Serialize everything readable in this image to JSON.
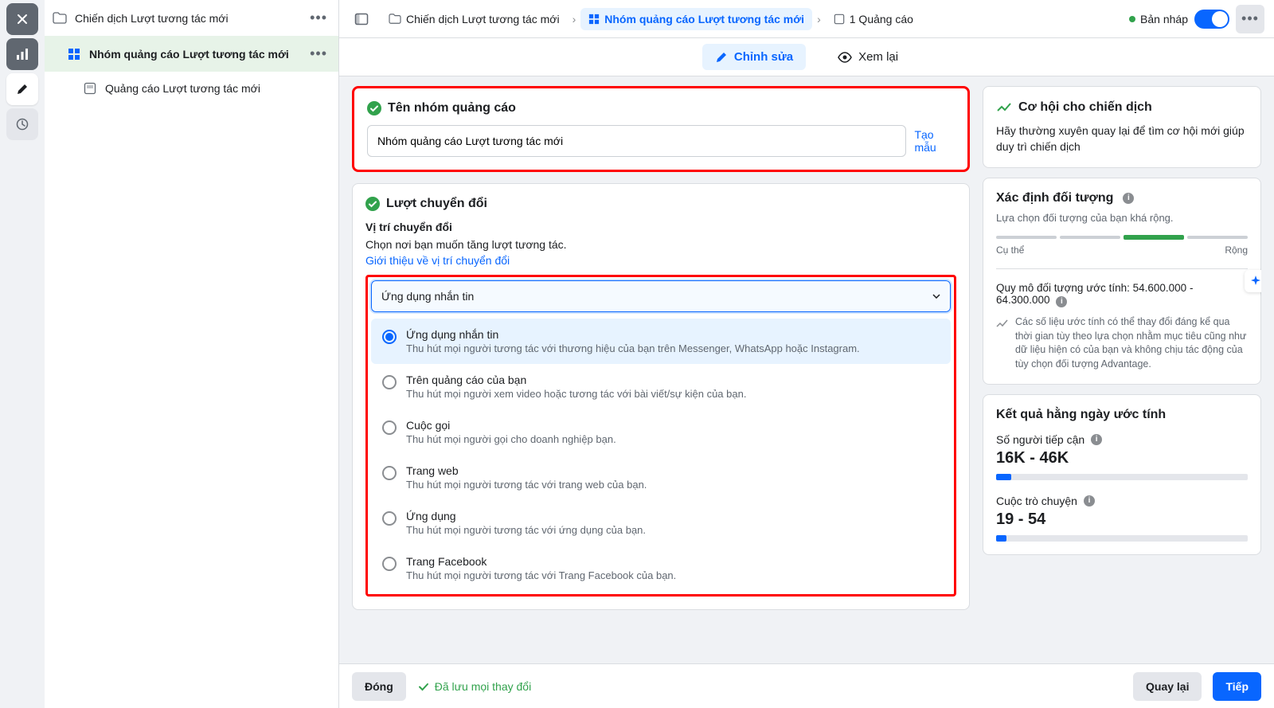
{
  "rail": {
    "close": "close",
    "chart": "chart",
    "edit": "edit",
    "clock": "clock"
  },
  "tree": {
    "campaign": "Chiến dịch Lượt tương tác mới",
    "adset": "Nhóm quảng cáo Lượt tương tác mới",
    "ad": "Quảng cáo Lượt tương tác mới"
  },
  "breadcrumb": {
    "campaign": "Chiến dịch Lượt tương tác mới",
    "adset": "Nhóm quảng cáo Lượt tương tác mới",
    "ad_count": "1 Quảng cáo"
  },
  "status": {
    "draft": "Bản nháp"
  },
  "tabs": {
    "edit": "Chỉnh sửa",
    "review": "Xem lại"
  },
  "form": {
    "name_section_title": "Tên nhóm quảng cáo",
    "name_value": "Nhóm quảng cáo Lượt tương tác mới",
    "create_template": "Tạo mẫu",
    "conv_section_title": "Lượt chuyển đổi",
    "conv_loc_label": "Vị trí chuyển đổi",
    "conv_loc_help": "Chọn nơi bạn muốn tăng lượt tương tác.",
    "conv_loc_link": "Giới thiệu về vị trí chuyển đổi",
    "select_value": "Ứng dụng nhắn tin",
    "options": [
      {
        "title": "Ứng dụng nhắn tin",
        "desc": "Thu hút mọi người tương tác với thương hiệu của bạn trên Messenger, WhatsApp hoặc Instagram.",
        "selected": true
      },
      {
        "title": "Trên quảng cáo của bạn",
        "desc": "Thu hút mọi người xem video hoặc tương tác với bài viết/sự kiện của bạn.",
        "selected": false
      },
      {
        "title": "Cuộc gọi",
        "desc": "Thu hút mọi người gọi cho doanh nghiệp bạn.",
        "selected": false
      },
      {
        "title": "Trang web",
        "desc": "Thu hút mọi người tương tác với trang web của bạn.",
        "selected": false
      },
      {
        "title": "Ứng dụng",
        "desc": "Thu hút mọi người tương tác với ứng dụng của bạn.",
        "selected": false
      },
      {
        "title": "Trang Facebook",
        "desc": "Thu hút mọi người tương tác với Trang Facebook của bạn.",
        "selected": false
      }
    ]
  },
  "side": {
    "opportunity_title": "Cơ hội cho chiến dịch",
    "opportunity_text": "Hãy thường xuyên quay lại để tìm cơ hội mới giúp duy trì chiến dịch",
    "audience_title": "Xác định đối tượng",
    "audience_sub": "Lựa chọn đối tượng của bạn khá rộng.",
    "gauge_left": "Cụ thể",
    "gauge_right": "Rộng",
    "size_label": "Quy mô đối tượng ước tính:",
    "size_value": "54.600.000 - 64.300.000",
    "size_note": "Các số liệu ước tính có thể thay đổi đáng kể qua thời gian tùy theo lựa chọn nhằm mục tiêu cũng như dữ liệu hiện có của bạn và không chịu tác động của tùy chọn đối tượng Advantage.",
    "results_title": "Kết quả hằng ngày ước tính",
    "reach_label": "Số người tiếp cận",
    "reach_value": "16K - 46K",
    "conv_label": "Cuộc trò chuyện",
    "conv_value": "19 - 54"
  },
  "footer": {
    "close": "Đóng",
    "saved": "Đã lưu mọi thay đổi",
    "back": "Quay lại",
    "next": "Tiếp"
  }
}
